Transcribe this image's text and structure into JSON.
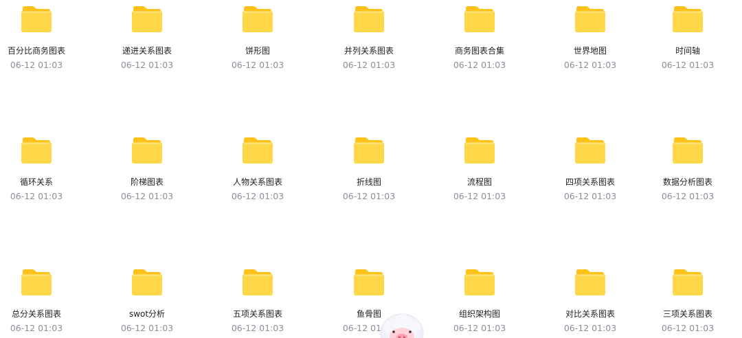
{
  "folders": [
    {
      "name": "百分比商务图表",
      "date": "06-12 01:03"
    },
    {
      "name": "递进关系图表",
      "date": "06-12 01:03"
    },
    {
      "name": "饼形图",
      "date": "06-12 01:03"
    },
    {
      "name": "并列关系图表",
      "date": "06-12 01:03"
    },
    {
      "name": "商务图表合集",
      "date": "06-12 01:03"
    },
    {
      "name": "世界地图",
      "date": "06-12 01:03"
    },
    {
      "name": "时间轴",
      "date": "06-12 01:03"
    },
    {
      "name": "循环关系",
      "date": "06-12 01:03"
    },
    {
      "name": "阶梯图表",
      "date": "06-12 01:03"
    },
    {
      "name": "人物关系图表",
      "date": "06-12 01:03"
    },
    {
      "name": "折线图",
      "date": "06-12 01:03"
    },
    {
      "name": "流程图",
      "date": "06-12 01:03"
    },
    {
      "name": "四项关系图表",
      "date": "06-12 01:03"
    },
    {
      "name": "数据分析图表",
      "date": "06-12 01:03"
    },
    {
      "name": "总分关系图表",
      "date": "06-12 01:03"
    },
    {
      "name": "swot分析",
      "date": "06-12 01:03"
    },
    {
      "name": "五项关系图表",
      "date": "06-12 01:03"
    },
    {
      "name": "鱼骨图",
      "date": "06-12 01:03"
    },
    {
      "name": "组织架构图",
      "date": "06-12 01:03"
    },
    {
      "name": "对比关系图表",
      "date": "06-12 01:03"
    },
    {
      "name": "三项关系图表",
      "date": "06-12 01:03"
    }
  ],
  "icons": {
    "folder": "folder-icon",
    "assistant": "assistant-mascot-icon"
  },
  "colors": {
    "folder_back": "#ffc21a",
    "folder_front": "#ffd84a",
    "folder_name": "#1f1f1f",
    "folder_date": "#8a8f99"
  }
}
